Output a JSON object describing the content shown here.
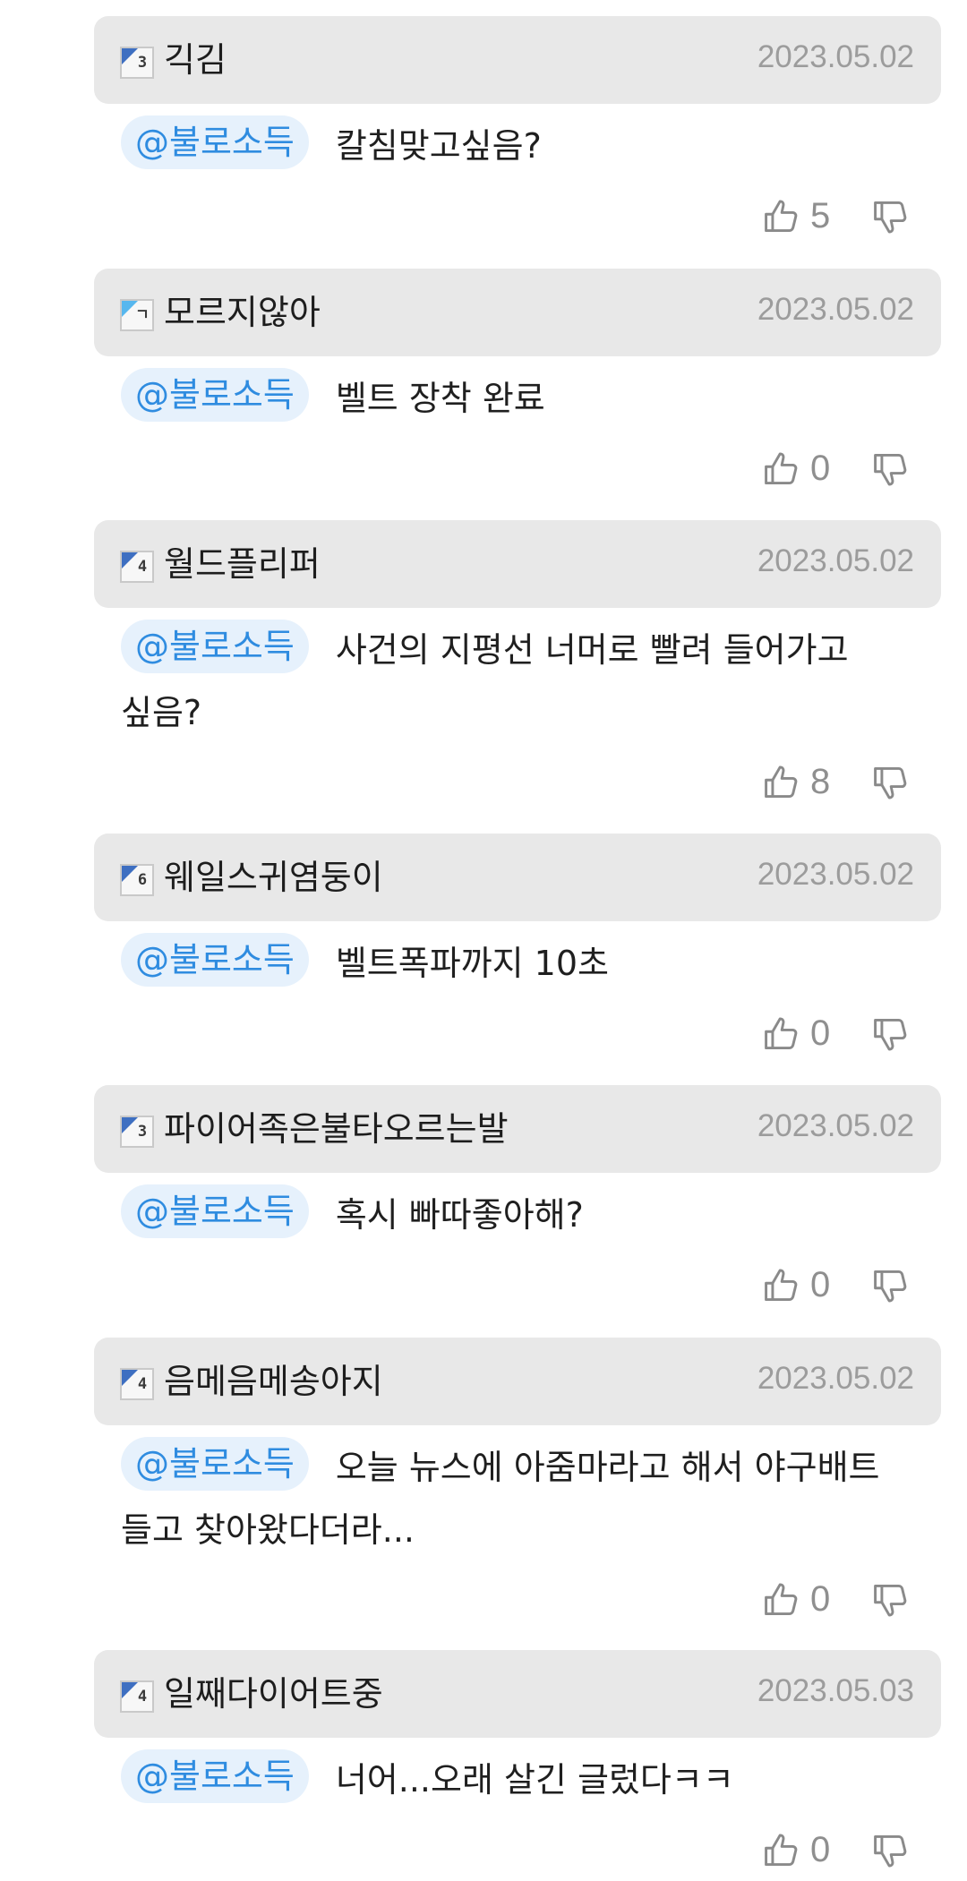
{
  "comments": [
    {
      "level": "3",
      "level_style": "dark",
      "nickname": "긱김",
      "date": "2023.05.02",
      "mention": "@불로소득",
      "text": "칼침맞고싶음?",
      "likes": "5"
    },
    {
      "level": "ㄱ",
      "level_style": "light",
      "nickname": "모르지않아",
      "date": "2023.05.02",
      "mention": "@불로소득",
      "text": "벨트 장착 완료",
      "likes": "0"
    },
    {
      "level": "4",
      "level_style": "dark",
      "nickname": "월드플리퍼",
      "date": "2023.05.02",
      "mention": "@불로소득",
      "text": "사건의 지평선 너머로 빨려 들어가고 싶음?",
      "likes": "8"
    },
    {
      "level": "6",
      "level_style": "dark",
      "nickname": "웨일스귀염둥이",
      "date": "2023.05.02",
      "mention": "@불로소득",
      "text": "벨트폭파까지 10초",
      "likes": "0"
    },
    {
      "level": "3",
      "level_style": "dark",
      "nickname": "파이어족은불타오르는발",
      "date": "2023.05.02",
      "mention": "@불로소득",
      "text": "혹시 빠따좋아해?",
      "likes": "0"
    },
    {
      "level": "4",
      "level_style": "dark",
      "nickname": "음메음메송아지",
      "date": "2023.05.02",
      "mention": "@불로소득",
      "text": "오늘 뉴스에 아줌마라고 해서 야구배트 들고 찾아왔다더라...",
      "likes": "0"
    },
    {
      "level": "4",
      "level_style": "dark",
      "nickname": "일째다이어트중",
      "date": "2023.05.03",
      "mention": "@불로소득",
      "text": "너어...오래 살긴 글렀다ㅋㅋ",
      "likes": "0"
    }
  ],
  "icons": {
    "like": "thumbs-up-icon",
    "dislike": "thumbs-down-icon"
  },
  "colors": {
    "header_bg": "#e8e8e8",
    "mention_text": "#2f8ce0",
    "mention_bg": "#e6f1fc",
    "date_text": "#9c9c9c",
    "level_dark": "#3e6fc1",
    "level_light": "#57b7ee"
  }
}
